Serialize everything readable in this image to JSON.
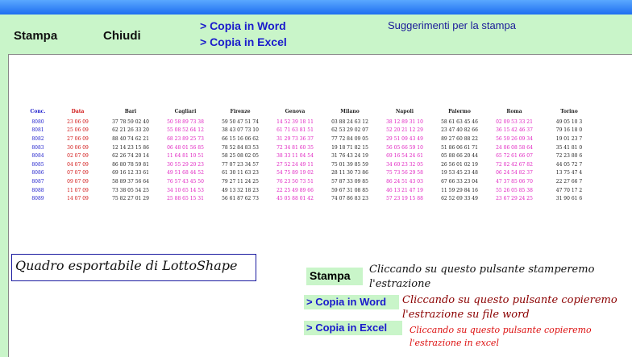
{
  "toolbar": {
    "stampa_label": "Stampa",
    "chiudi_label": "Chiudi",
    "copia_word_label": "> Copia in Word",
    "copia_excel_label": "> Copia in Excel",
    "suggerimenti_label": "Suggerimenti per la stampa"
  },
  "table": {
    "headers": [
      "Conc.",
      "Data",
      "Bari",
      "Cagliari",
      "Firenze",
      "Genova",
      "Milano",
      "Napoli",
      "Palermo",
      "Roma",
      "Torino"
    ],
    "rows": [
      [
        "8080",
        "23 06 09",
        "37 78 59 02 40",
        "50 58 89 73 38",
        "59 50 47 51 74",
        "14 52 39 18 11",
        "03 88 24 63 12",
        "38 12 89 31 10",
        "58 61 63 45 46",
        "02 09 53 33 21",
        "49 05 10 3"
      ],
      [
        "8081",
        "25 06 09",
        "62 21 26 33 20",
        "55 08 52 64 12",
        "38 43 07 73 10",
        "61 71 63 81 51",
        "62 53 29 02 07",
        "52 20 21 12 29",
        "23 47 40 82 66",
        "36 15 42 46 37",
        "79 16 18 0"
      ],
      [
        "8082",
        "27 06 09",
        "88 40 74 62 21",
        "68 23 89 25 73",
        "66 15 16 06 62",
        "31 29 73 36 37",
        "77 72 84 09 05",
        "29 51 09 43 49",
        "89 27 60 88 22",
        "56 59 26 09 34",
        "19 01 23 7"
      ],
      [
        "8083",
        "30 06 09",
        "12 14 23 15 86",
        "06 48 01 56 85",
        "78 52 84 83 53",
        "72 34 81 60 35",
        "19 18 71 82 15",
        "56 05 66 59 10",
        "51 86 06 61 71",
        "24 06 08 58 64",
        "35 41 81 0"
      ],
      [
        "8084",
        "02 07 09",
        "62 26 74 20 14",
        "11 64 81 10 51",
        "58 25 08 02 05",
        "38 33 11 04 54",
        "31 76 43 24 19",
        "69 16 54 24 61",
        "05 88 66 20 44",
        "65 72 61 66 07",
        "72 23 80 6"
      ],
      [
        "8085",
        "04 07 09",
        "86 80 78 59 81",
        "30 55 29 20 23",
        "77 07 23 34 57",
        "27 52 24 49 11",
        "75 01 39 85 59",
        "34 60 23 32 05",
        "26 56 01 02 19",
        "72 02 42 67 82",
        "44 05 72 7"
      ],
      [
        "8086",
        "07 07 09",
        "69 16 12 33 61",
        "49 51 68 44 52",
        "61 30 11 63 23",
        "54 75 89 19 02",
        "28 11 30 73 86",
        "75 73 56 29 58",
        "19 53 45 23 48",
        "06 24 54 82 37",
        "13 75 47 4"
      ],
      [
        "8087",
        "09 07 09",
        "58 89 37 56 64",
        "76 57 43 45 50",
        "79 27 11 24 25",
        "76 23 50 73 51",
        "57 87 33 09 85",
        "86 24 51 43 03",
        "67 66 33 23 04",
        "47 37 85 06 70",
        "22 27 66 7"
      ],
      [
        "8088",
        "11 07 09",
        "73 38 05 54 25",
        "34 10 65 14 53",
        "49 13 32 18 23",
        "22 25 49 89 66",
        "59 67 31 08 85",
        "46 13 21 47 19",
        "11 59 29 84 16",
        "55 26 05 85 38",
        "47 70 17 2"
      ],
      [
        "8089",
        "14 07 09",
        "75 82 27 01 29",
        "25 88 65 15 31",
        "56 61 87 62 73",
        "45 05 88 01 42",
        "74 07 86 83 23",
        "57 23 19 15 88",
        "62 52 69 33 49",
        "23 67 29 24 25",
        "31 90 61 6"
      ]
    ]
  },
  "export_box_text": "Quadro esportabile di LottoShape",
  "legend": [
    {
      "button": "Stampa",
      "text": "Cliccando su questo pulsante stamperemo l'estrazione",
      "color": "#111111"
    },
    {
      "button": "> Copia in Word",
      "text": "Cliccando su questo pulsante copieremo l'estrazione su file word",
      "color": "#8b0000"
    },
    {
      "button": "> Copia in Excel",
      "text": "Cliccando su questo pulsante copieremo l'estrazione in excel",
      "color": "#dd1010"
    }
  ]
}
